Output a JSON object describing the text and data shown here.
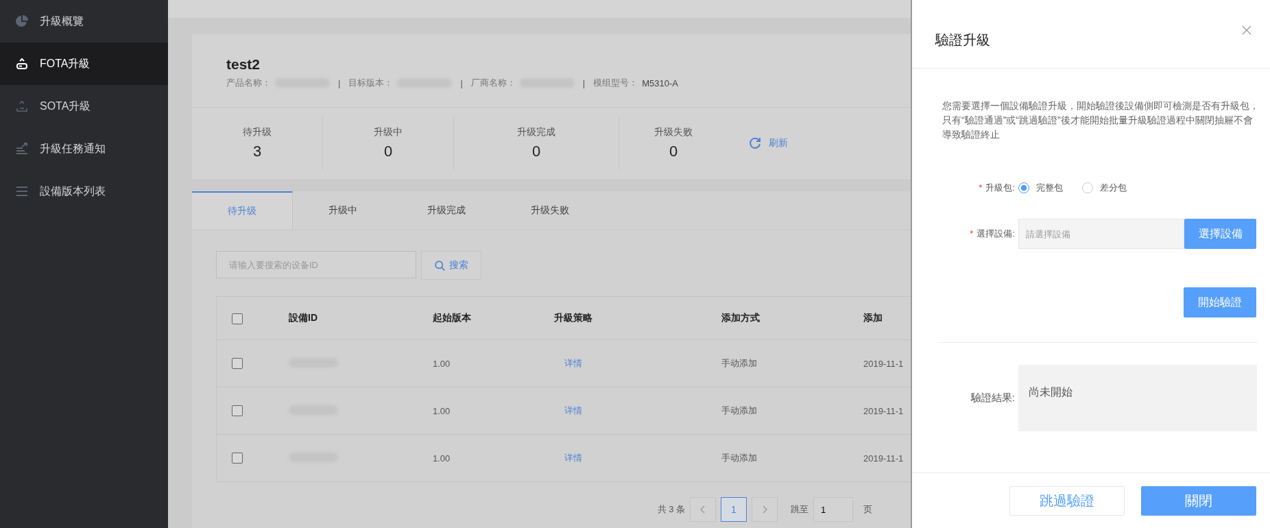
{
  "sidebar": {
    "items": [
      {
        "label": "升級概覽",
        "selected": false
      },
      {
        "label": "FOTA升級",
        "selected": true
      },
      {
        "label": "SOTA升級",
        "selected": false
      },
      {
        "label": "升級任務通知",
        "selected": false
      },
      {
        "label": "設備版本列表",
        "selected": false
      }
    ]
  },
  "product": {
    "title": "test2",
    "info": [
      {
        "label": "产品名称：",
        "redacted": true
      },
      {
        "separator": "|",
        "label": "目标版本：",
        "redacted": true
      },
      {
        "separator": "|",
        "label": "厂商名称：",
        "redacted": true
      },
      {
        "separator": "|",
        "label": "模组型号：",
        "value": "M5310-A"
      }
    ]
  },
  "stats": [
    {
      "label": "待升级",
      "value": "3"
    },
    {
      "label": "升级中",
      "value": "0"
    },
    {
      "label": "升级完成",
      "value": "0"
    },
    {
      "label": "升级失败",
      "value": "0"
    }
  ],
  "refresh": "刷新",
  "tabs": [
    {
      "label": "待升级",
      "selected": true
    },
    {
      "label": "升级中",
      "selected": false
    },
    {
      "label": "升级完成",
      "selected": false
    },
    {
      "label": "升级失败",
      "selected": false
    }
  ],
  "search": {
    "placeholder": "请输入要搜索的设备ID",
    "button": "搜索"
  },
  "table": {
    "select_all": {
      "checked": false
    },
    "columns": [
      "設備ID",
      "起始版本",
      "升級策略",
      "添加方式",
      "添加"
    ],
    "rows": [
      {
        "checked": false,
        "start_version": "1.00",
        "strategy": "详情",
        "add_method": "手动添加",
        "added_time": "2019-11-1"
      },
      {
        "checked": false,
        "start_version": "1.00",
        "strategy": "详情",
        "add_method": "手动添加",
        "added_time": "2019-11-1"
      },
      {
        "checked": false,
        "start_version": "1.00",
        "strategy": "详情",
        "add_method": "手动添加",
        "added_time": "2019-11-1"
      }
    ]
  },
  "pagination": {
    "total": "共 3 条",
    "pages": [
      {
        "label": "1",
        "selected": true
      }
    ],
    "jump_label": "跳至",
    "jump_value": "1",
    "unit": "页"
  },
  "drawer": {
    "title": "驗證升級",
    "description": "您需要選擇一個設備驗證升級，開始驗證後設備側即可檢測是否有升級包，只有“驗證通過”或“跳過驗證”後才能開始批量升級驗證過程中關閉抽屜不會導致驗證終止",
    "package": {
      "label": "升級包:",
      "required_mark": "*",
      "options": [
        {
          "label": "完整包",
          "selected": true
        },
        {
          "label": "差分包",
          "selected": false
        }
      ]
    },
    "device": {
      "label": "選擇設備:",
      "required_mark": "*",
      "placeholder": "請選擇設備",
      "button": "選擇設備"
    },
    "start_button": "開始驗證",
    "result": {
      "label": "驗證結果:",
      "value": "尚未開始"
    },
    "footer": {
      "skip_button": "跳過驗證",
      "close_button": "關閉"
    }
  }
}
